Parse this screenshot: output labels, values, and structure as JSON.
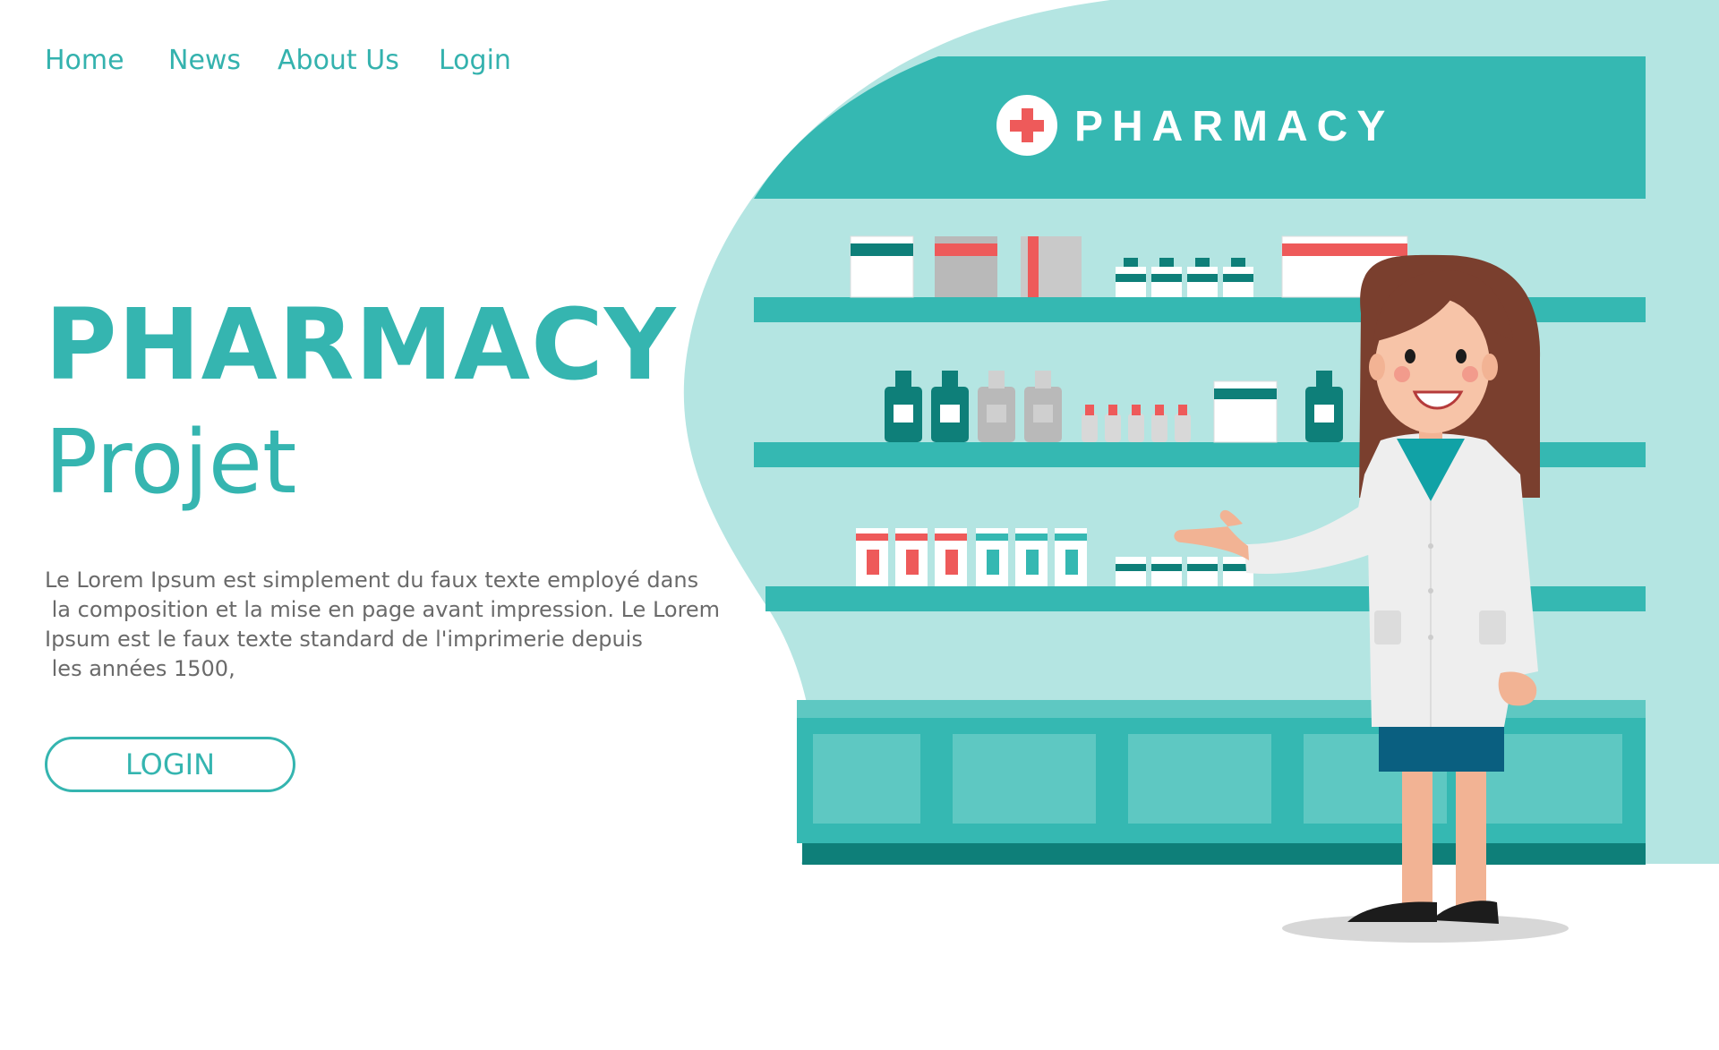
{
  "nav": {
    "items": [
      "Home",
      "News",
      "About Us",
      "Login"
    ]
  },
  "hero": {
    "title": "PHARMACY",
    "subtitle": "Projet",
    "description_lines": [
      "Le Lorem Ipsum est simplement du faux texte employé dans",
      " la composition et la mise en page avant impression. Le Lorem",
      "Ipsum est le faux texte standard de l'imprimerie depuis",
      " les années 1500,"
    ],
    "button_label": "LOGIN"
  },
  "illustration": {
    "sign_text": "PHARMACY"
  },
  "colors": {
    "accent": "#35b5b0",
    "light_teal": "#b4e5e2",
    "dark_teal": "#0e7f79",
    "cross_red": "#ee5a5a"
  }
}
